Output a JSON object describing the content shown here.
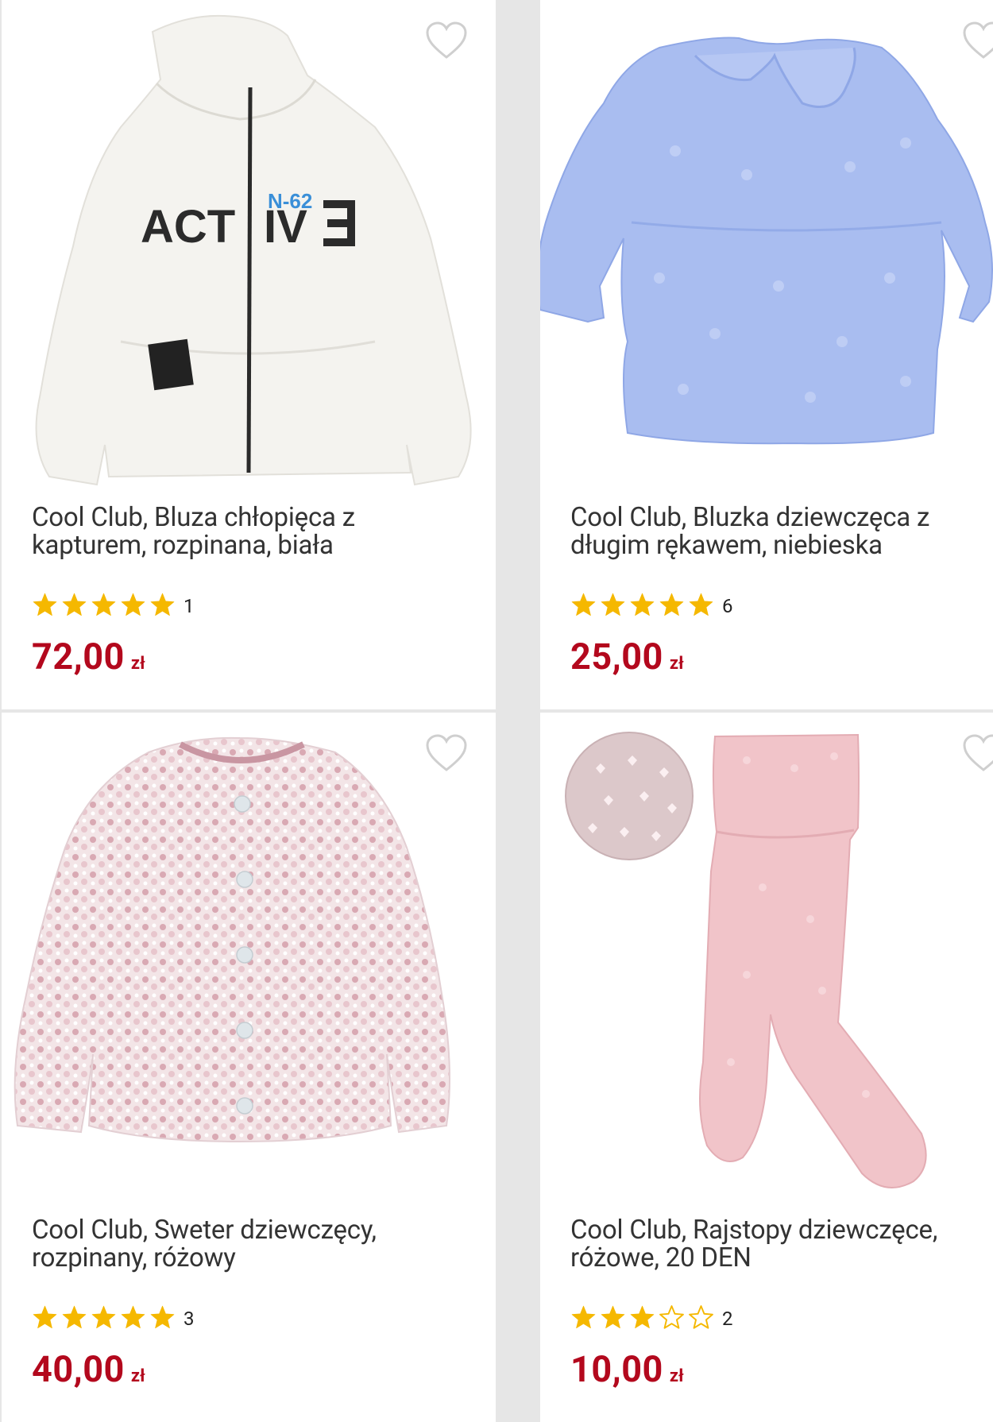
{
  "products": [
    {
      "title": "Cool Club, Bluza chłopięca z kapturem, rozpinana, biała",
      "rating": 5,
      "review_count": "1",
      "price": "72,00",
      "currency": "zł",
      "print_text": "ACT",
      "print_text2": "IV",
      "print_tag": "N-62"
    },
    {
      "title": "Cool Club, Bluzka dziewczęca z długim rękawem, niebieska",
      "rating": 5,
      "review_count": "6",
      "price": "25,00",
      "currency": "zł"
    },
    {
      "title": "Cool Club, Sweter dziewczęcy, rozpinany, różowy",
      "rating": 5,
      "review_count": "3",
      "price": "40,00",
      "currency": "zł"
    },
    {
      "title": "Cool Club, Rajstopy dziewczęce, różowe, 20 DEN",
      "rating": 3,
      "review_count": "2",
      "price": "10,00",
      "currency": "zł"
    }
  ],
  "colors": {
    "price": "#b3081d",
    "star": "#f5b800",
    "background": "#e6e6e6"
  },
  "icons": {
    "wishlist": "heart-outline-icon",
    "star_full": "star-filled-icon",
    "star_empty": "star-outline-icon"
  }
}
